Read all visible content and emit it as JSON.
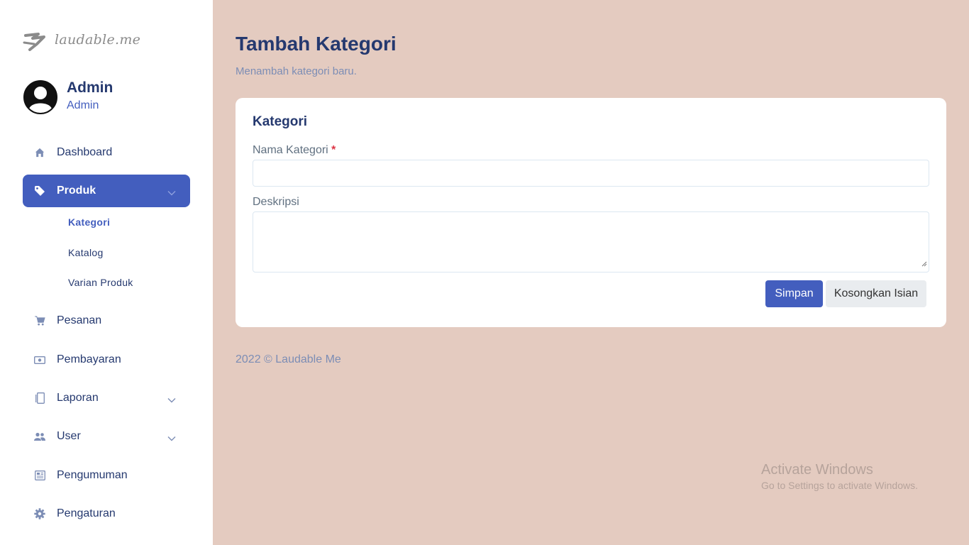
{
  "brand": {
    "logo_text": "laudable.me"
  },
  "profile": {
    "name": "Admin",
    "role": "Admin"
  },
  "sidebar": {
    "items": [
      {
        "label": "Dashboard",
        "icon": "house-icon"
      },
      {
        "label": "Produk",
        "icon": "tag-icon",
        "active": true,
        "expanded": true
      },
      {
        "label": "Pesanan",
        "icon": "cart-icon"
      },
      {
        "label": "Pembayaran",
        "icon": "cash-icon"
      },
      {
        "label": "Laporan",
        "icon": "journal-icon",
        "has_submenu": true
      },
      {
        "label": "User",
        "icon": "people-icon",
        "has_submenu": true
      },
      {
        "label": "Pengumuman",
        "icon": "newspaper-icon"
      },
      {
        "label": "Pengaturan",
        "icon": "gear-icon"
      }
    ],
    "produk_submenu": [
      {
        "label": "Kategori",
        "active": true
      },
      {
        "label": "Katalog"
      },
      {
        "label": "Varian Produk"
      }
    ]
  },
  "page": {
    "title": "Tambah Kategori",
    "subtitle": "Menambah kategori baru."
  },
  "form": {
    "card_title": "Kategori",
    "name_label": "Nama Kategori",
    "required_mark": "*",
    "name_value": "",
    "description_label": "Deskripsi",
    "description_value": "",
    "save_label": "Simpan",
    "reset_label": "Kosongkan Isian"
  },
  "footer": {
    "text": "2022 © Laudable Me"
  },
  "watermark": {
    "title": "Activate Windows",
    "subtitle": "Go to Settings to activate Windows."
  },
  "colors": {
    "primary": "#435ebe",
    "background": "#e4cbc0",
    "text_dark": "#25396f",
    "required": "#dc3545"
  }
}
